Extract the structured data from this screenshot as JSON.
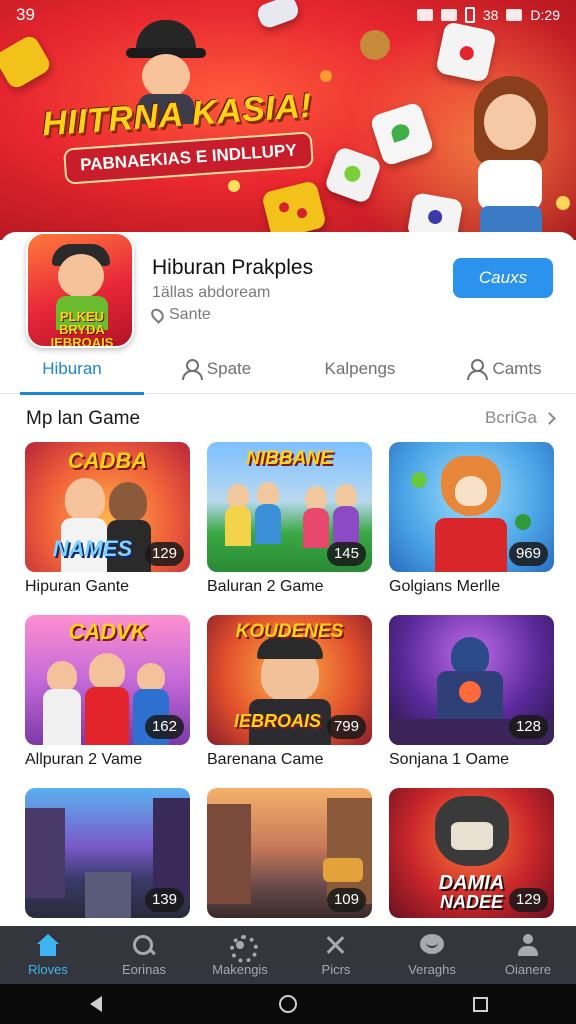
{
  "status_bar": {
    "time": "39",
    "clock": "D:29",
    "indicator": "38"
  },
  "banner": {
    "title": "HIITRNA KASIA!",
    "subtitle": "PABNAEKIAS E INDLLUPY"
  },
  "app": {
    "icon_text": "PLKEU BRYDA IEBROAIS",
    "name": "Hiburan Prakples",
    "developer": "1ällas abdoream",
    "meta": "Sante",
    "install_label": "Cauxs"
  },
  "tabs": [
    {
      "label": "Hiburan",
      "active": true
    },
    {
      "label": "Spate"
    },
    {
      "label": "Kalpengs"
    },
    {
      "label": "Camts"
    }
  ],
  "section": {
    "title": "Mp lan Game",
    "more": "BcriGa"
  },
  "games": [
    {
      "title": "Hipuran Gante",
      "badge": "129",
      "overlay": "CADBA",
      "overlay2": "NAMES"
    },
    {
      "title": "Baluran 2 Game",
      "badge": "145",
      "overlay": "NIBBANE"
    },
    {
      "title": "Golgians Merlle",
      "badge": "969"
    },
    {
      "title": "Allpuran 2 Vame",
      "badge": "162",
      "overlay": "CADVK"
    },
    {
      "title": "Barenana Came",
      "badge": "799",
      "overlay": "KOUDENES",
      "overlay2": "IEBROAIS"
    },
    {
      "title": "Sonjana 1 Oame",
      "badge": "128"
    },
    {
      "title": "",
      "badge": "139"
    },
    {
      "title": "",
      "badge": "109"
    },
    {
      "title": "",
      "badge": "129",
      "overlay": "DAMIA",
      "overlay2": "NADEE"
    }
  ],
  "bottom_nav": [
    {
      "label": "Rloves",
      "icon": "home-icon",
      "active": true
    },
    {
      "label": "Eorinas",
      "icon": "search-icon"
    },
    {
      "label": "Makengis",
      "icon": "gear-icon"
    },
    {
      "label": "Picrs",
      "icon": "tools-icon"
    },
    {
      "label": "Veraghs",
      "icon": "chat-icon"
    },
    {
      "label": "Oianere",
      "icon": "user-icon"
    }
  ],
  "colors": {
    "accent": "#1e84d4",
    "install": "#2b93ee",
    "nav_bg": "#33363d",
    "nav_active": "#3fb4f3",
    "banner_red": "#e7262f"
  }
}
